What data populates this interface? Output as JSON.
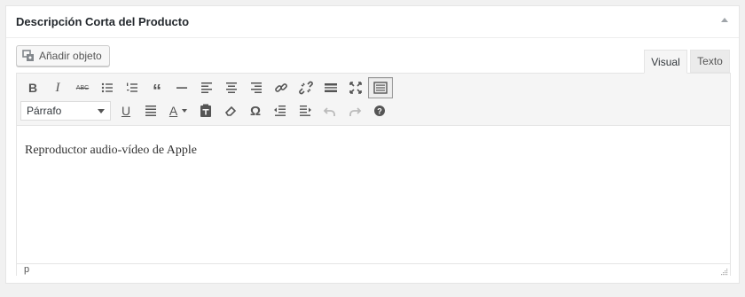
{
  "postbox": {
    "title": "Descripción Corta del Producto",
    "toggle_icon": "triangle-up-icon"
  },
  "media_button": {
    "label": "Añadir objeto",
    "icon": "media-icon"
  },
  "tabs": [
    {
      "label": "Visual",
      "active": true
    },
    {
      "label": "Texto",
      "active": false
    }
  ],
  "toolbar": {
    "row1": [
      "bold-icon",
      "italic-icon",
      "strikethrough-icon",
      "bullet-list-icon",
      "numbered-list-icon",
      "blockquote-icon",
      "horizontal-rule-icon",
      "align-left-icon",
      "align-center-icon",
      "align-right-icon",
      "link-icon",
      "unlink-icon",
      "read-more-icon",
      "fullscreen-icon",
      "toolbar-toggle-icon"
    ],
    "format_select": "Párrafo",
    "row2": [
      "underline-icon",
      "justify-icon",
      "text-color-icon",
      "paste-text-icon",
      "clear-formatting-icon",
      "special-character-icon",
      "outdent-icon",
      "indent-icon",
      "undo-icon",
      "redo-icon",
      "help-icon"
    ],
    "labels": {
      "bold": "B",
      "italic": "I",
      "strike": "ABC",
      "quote": "“",
      "underline": "U",
      "textcolor": "A",
      "omega": "Ω"
    }
  },
  "editor": {
    "content": "Reproductor audio-vídeo de Apple"
  },
  "statusbar": {
    "path": "p"
  },
  "colors": {
    "background": "#f1f1f1",
    "panel": "#ffffff",
    "toolbar": "#f5f5f5",
    "icon": "#555555"
  }
}
